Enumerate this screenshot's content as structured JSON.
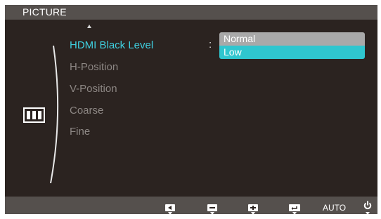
{
  "header": {
    "title": "PICTURE"
  },
  "menu": {
    "items": [
      {
        "label": "HDMI Black Level",
        "active": true
      },
      {
        "label": "H-Position",
        "active": false
      },
      {
        "label": "V-Position",
        "active": false
      },
      {
        "label": "Coarse",
        "active": false
      },
      {
        "label": "Fine",
        "active": false
      }
    ],
    "separator": ":"
  },
  "dropdown": {
    "options": [
      {
        "label": "Normal"
      },
      {
        "label": "Low",
        "selected": true
      }
    ]
  },
  "bottom_bar": {
    "auto_label": "AUTO",
    "buttons": [
      "left-arrow-icon",
      "minus-icon",
      "plus-icon",
      "enter-icon",
      "auto",
      "power-icon"
    ]
  },
  "colors": {
    "accent": "#3fd0e0",
    "selected_bg": "#2fc6cf",
    "panel_bg": "#2b2320",
    "bar_bg": "#55504d"
  }
}
